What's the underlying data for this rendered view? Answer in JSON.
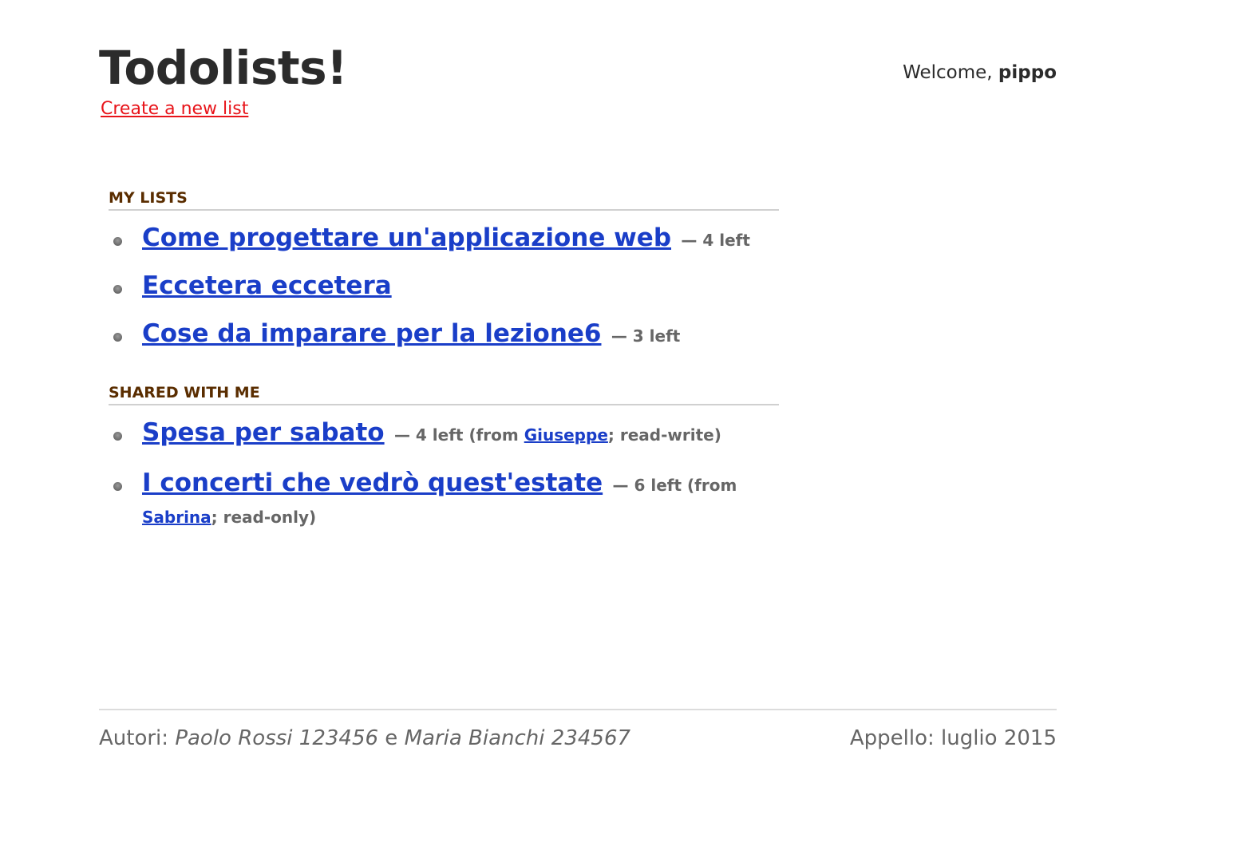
{
  "header": {
    "title": "Todolists!",
    "create_link": "Create a new list",
    "welcome_prefix": "Welcome, ",
    "username": "pippo"
  },
  "my_lists": {
    "heading": "MY LISTS",
    "items": [
      {
        "title": "Come progettare un'applicazione web",
        "meta": "— 4 left"
      },
      {
        "title": "Eccetera eccetera",
        "meta": ""
      },
      {
        "title": "Cose da imparare per la lezione6",
        "meta": "— 3 left"
      }
    ]
  },
  "shared": {
    "heading": "SHARED WITH ME",
    "items": [
      {
        "title": "Spesa per sabato",
        "meta_prefix": "— 4 left (from ",
        "owner": "Giuseppe",
        "meta_suffix": "; read-write)"
      },
      {
        "title": "I concerti che vedrò quest'estate",
        "meta_prefix": "— 6 left (from ",
        "owner": "Sabrina",
        "meta_suffix": "; read-only)"
      }
    ]
  },
  "footer": {
    "authors_label": "Autori: ",
    "author1": "Paolo Rossi 123456",
    "conjunction": " e ",
    "author2": "Maria Bianchi 234567",
    "appello": "Appello: luglio 2015"
  },
  "colors": {
    "link": "#1a3ec8",
    "create_link": "#e8141a",
    "section_heading": "#5a2d00"
  }
}
